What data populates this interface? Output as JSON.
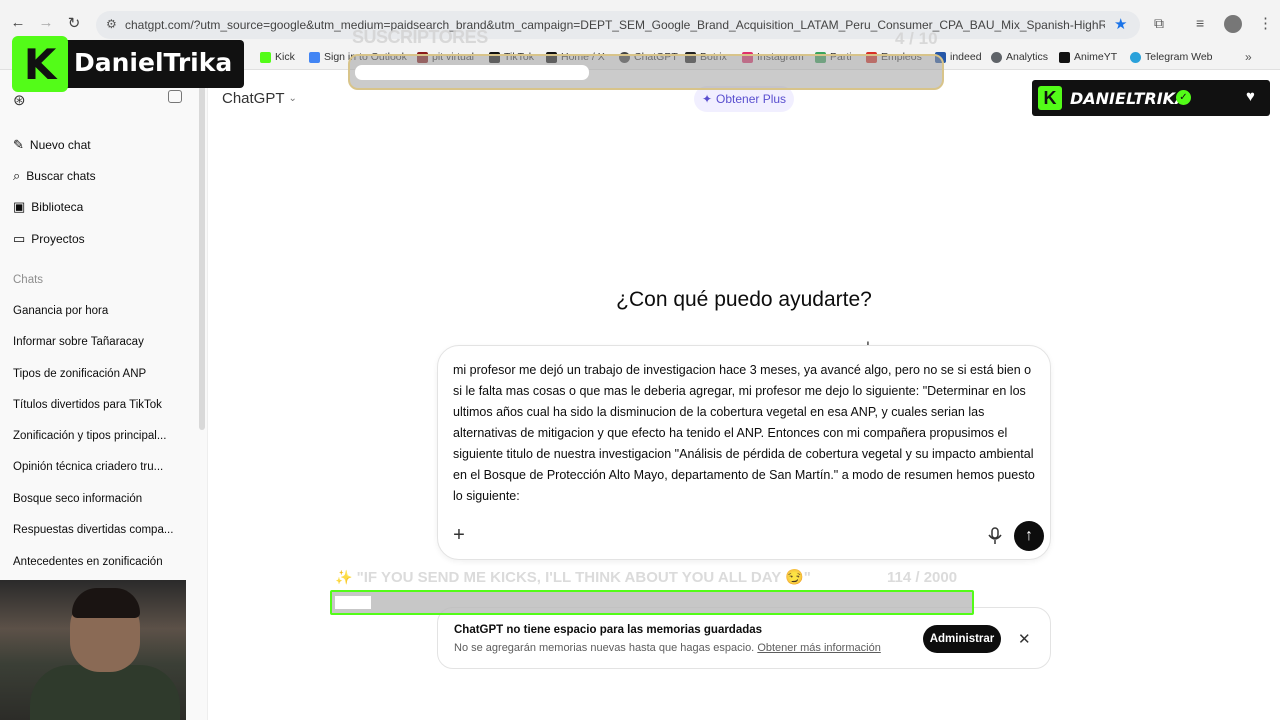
{
  "browser": {
    "url": "chatgpt.com/?utm_source=google&utm_medium=paidsearch_brand&utm_campaign=DEPT_SEM_Google_Brand_Acquisition_LATAM_Peru_Consumer_CPA_BAU_Mix_Spanish-HighRisk&utm_term=c...",
    "bookmarks": [
      "Kick",
      "Sign in to Outlook",
      "pit virtual",
      "TikTok",
      "Home / X",
      "ChatGPT",
      "Botrix",
      "Instagram",
      "Parti",
      "Empleos",
      "indeed",
      "Analytics",
      "AnimeYT",
      "Telegram Web"
    ]
  },
  "sidebar": {
    "top_items": [
      "Nuevo chat",
      "Buscar chats",
      "Biblioteca",
      "Proyectos"
    ],
    "chats_label": "Chats",
    "chats": [
      "Ganancia por hora",
      "Informar sobre Tañaracay",
      "Tipos de zonificación ANP",
      "Títulos divertidos para TikTok",
      "Zonificación y tipos principal...",
      "Opinión técnica criadero tru...",
      "Bosque seco información",
      "Respuestas divertidas compa...",
      "Antecedentes en zonificación"
    ]
  },
  "main": {
    "model": "ChatGPT",
    "upgrade_label": "Obtener Plus",
    "heading": "¿Con qué puedo ayudarte?",
    "prompt": "mi profesor me dejó un trabajo de investigacion hace 3 meses, ya avancé algo, pero no se si está bien o si le falta mas cosas o que mas le deberia agregar, mi profesor me dejo lo siguiente: \"Determinar en los ultimos años cual ha sido la disminucion de la cobertura vegetal en esa ANP, y cuales serian las alternativas de mitigacion y que efecto ha tenido el ANP. Entonces con mi compañera propusimos el siguiente titulo de nuestra investigacion \"Análisis de pérdida de cobertura vegetal y su impacto ambiental  en el Bosque de Protección Alto Mayo, departamento de San  Martín.\" a modo de resumen hemos puesto lo siguiente:"
  },
  "banner": {
    "title": "ChatGPT no tiene espacio para las memorias guardadas",
    "body": "No se agregarán memorias nuevas hasta que hagas espacio.",
    "link": "Obtener más información",
    "button": "Administrar"
  },
  "overlay": {
    "logo_name": "DanielTrika",
    "subs_label": "SUSCRIPTORES",
    "subs_count": "4 / 10",
    "subs_progress": 0.4,
    "badge_name": "DANIELTRIKA",
    "goal_text": "\"IF YOU SEND ME KICKS, I'LL THINK ABOUT YOU ALL DAY 😏\"",
    "goal_count": "114  / 2000",
    "goal_progress": 0.057
  },
  "icons": {
    "new_chat": "pencil-square-icon",
    "search": "search-icon",
    "library": "library-icon",
    "projects": "folder-icon"
  },
  "colors": {
    "kick_green": "#53fc18",
    "plus_accent": "#5a4fcf"
  }
}
